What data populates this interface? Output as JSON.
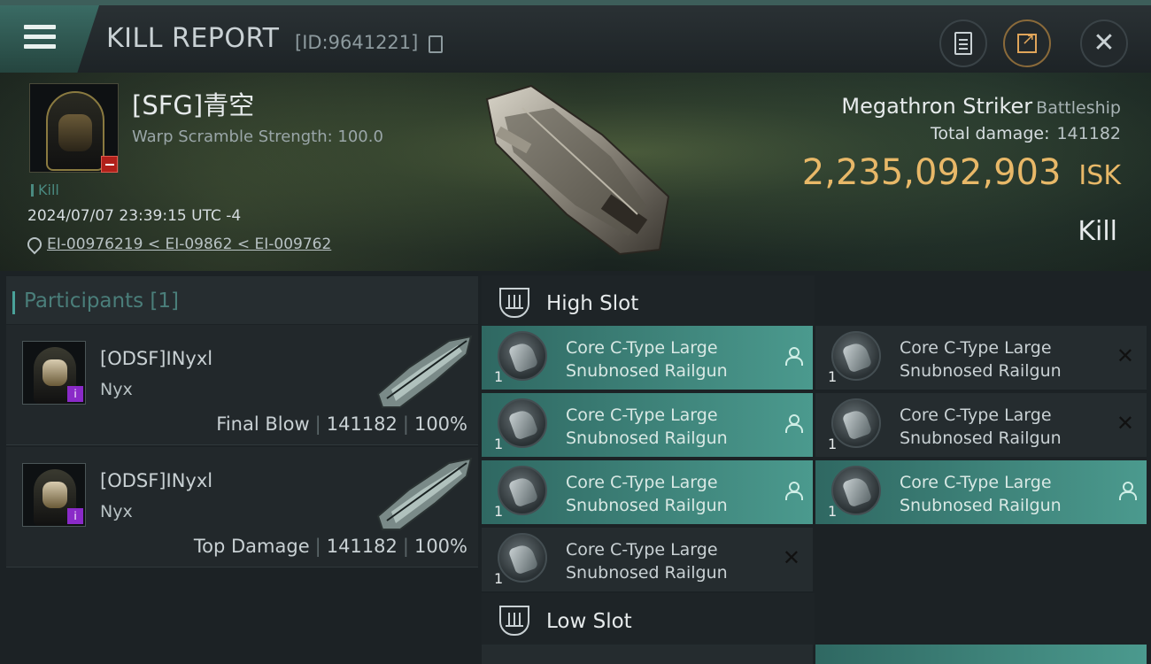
{
  "header": {
    "title": "KILL REPORT",
    "id_text": "[ID:9641221]",
    "buttons": [
      "document-icon",
      "share-icon",
      "close-icon"
    ],
    "accent": "#3d5e5a"
  },
  "victim": {
    "name": "[SFG]青空",
    "warp_scramble": "Warp Scramble Strength: 100.0",
    "tag": "Kill",
    "datetime": "2024/07/07 23:39:15 UTC -4",
    "location": "EI-00976219 < EI-09862 < EI-009762"
  },
  "ship": {
    "name": "Megathron Striker",
    "class": "Battleship",
    "total_damage_label": "Total damage:",
    "total_damage_value": "141182",
    "isk_value": "2,235,092,903",
    "isk_unit": "ISK",
    "result": "Kill",
    "isk_color": "#e8b868"
  },
  "participants": {
    "header": "Participants [1]",
    "rows": [
      {
        "name": "[ODSF]INyxl",
        "ship": "Nyx",
        "role": "Final Blow",
        "damage": "141182",
        "percent": "100%"
      },
      {
        "name": "[ODSF]INyxl",
        "ship": "Nyx",
        "role": "Top Damage",
        "damage": "141182",
        "percent": "100%"
      }
    ]
  },
  "slots": {
    "high_title": "High Slot",
    "low_title": "Low Slot",
    "modules": [
      {
        "qty": "1",
        "line1": "Core C-Type Large",
        "line2": "Snubnosed Railgun",
        "state": "person"
      },
      {
        "qty": "1",
        "line1": "Core C-Type Large",
        "line2": "Snubnosed Railgun",
        "state": "x"
      },
      {
        "qty": "1",
        "line1": "Core C-Type Large",
        "line2": "Snubnosed Railgun",
        "state": "person"
      },
      {
        "qty": "1",
        "line1": "Core C-Type Large",
        "line2": "Snubnosed Railgun",
        "state": "x"
      },
      {
        "qty": "1",
        "line1": "Core C-Type Large",
        "line2": "Snubnosed Railgun",
        "state": "person"
      },
      {
        "qty": "1",
        "line1": "Core C-Type Large",
        "line2": "Snubnosed Railgun",
        "state": "person"
      },
      {
        "qty": "1",
        "line1": "Core C-Type Large",
        "line2": "Snubnosed Railgun",
        "state": "x"
      }
    ],
    "active_color": "#4b9a8e"
  }
}
